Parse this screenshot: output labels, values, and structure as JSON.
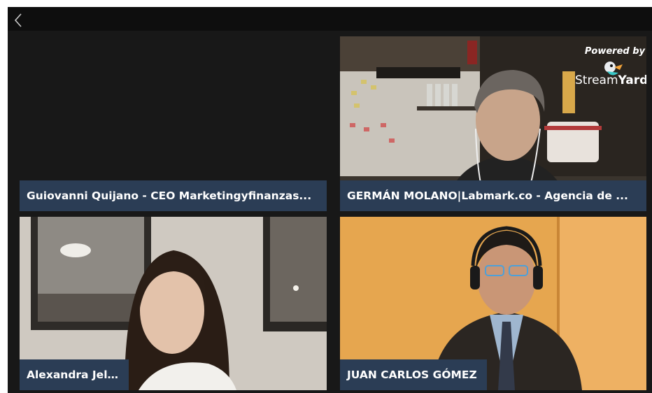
{
  "nav": {
    "back_icon": "chevron-left-icon"
  },
  "branding": {
    "powered_by": "Powered by",
    "brand_part1": "Stream",
    "brand_part2": "Yard",
    "logo_icon": "streamyard-duck-logo"
  },
  "participants": [
    {
      "name": "Guiovanni Quijano - CEO Marketingyfinanzas...",
      "video": "off"
    },
    {
      "name": "GERMÁN MOLANO|Labmark.co - Agencia de ...",
      "video": "on"
    },
    {
      "name": "Alexandra Jelkh",
      "video": "on"
    },
    {
      "name": "JUAN CARLOS GÓMEZ",
      "video": "on"
    }
  ],
  "colors": {
    "nameplate": "#2b3d55",
    "background": "#181818",
    "accent": "#e5a44d"
  }
}
